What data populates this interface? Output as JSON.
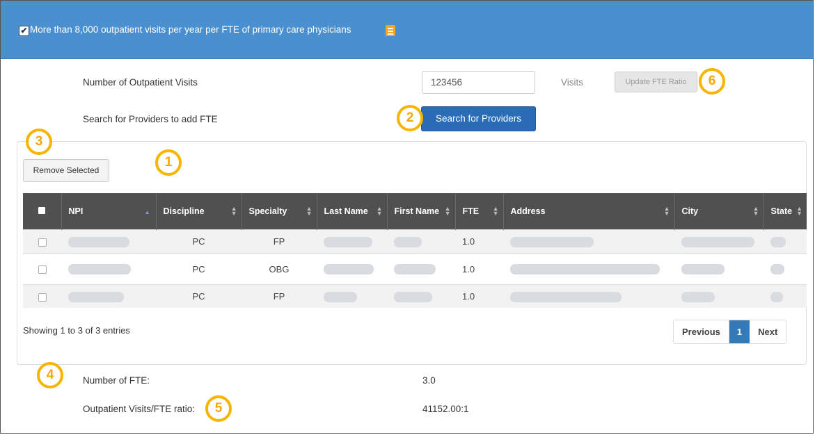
{
  "header": {
    "criterion_text": "More than 8,000 outpatient visits per year per FTE of primary care physicians",
    "checked": true
  },
  "icons": {
    "header_checkbox": "checkmark-icon",
    "document": "document-icon",
    "sort": "sort-icon",
    "sort_asc": "sort-ascending-icon"
  },
  "form": {
    "visits_label": "Number of Outpatient Visits",
    "visits_value": "123456",
    "visits_unit": "Visits",
    "update_button": "Update FTE Ratio",
    "search_label": "Search for Providers to add FTE",
    "search_button": "Search for Providers"
  },
  "table": {
    "remove_button": "Remove Selected",
    "columns": [
      "NPI",
      "Discipline",
      "Specialty",
      "Last Name",
      "First Name",
      "FTE",
      "Address",
      "City",
      "State"
    ],
    "rows": [
      {
        "discipline": "PC",
        "specialty": "FP",
        "fte": "1.0"
      },
      {
        "discipline": "PC",
        "specialty": "OBG",
        "fte": "1.0"
      },
      {
        "discipline": "PC",
        "specialty": "FP",
        "fte": "1.0"
      }
    ],
    "showing": "Showing 1 to 3 of 3 entries",
    "pagination": {
      "previous": "Previous",
      "current": "1",
      "next": "Next"
    }
  },
  "summary": {
    "fte_label": "Number of FTE:",
    "fte_value": "3.0",
    "ratio_label": "Outpatient Visits/FTE ratio:",
    "ratio_value": "41152.00:1"
  },
  "callouts": [
    "1",
    "2",
    "3",
    "4",
    "5",
    "6"
  ],
  "colors": {
    "header_bg": "#4a90d0",
    "primary_button": "#2a6cb5",
    "table_header": "#505050",
    "callout": "#f5b500",
    "pager_active": "#337ab7"
  }
}
